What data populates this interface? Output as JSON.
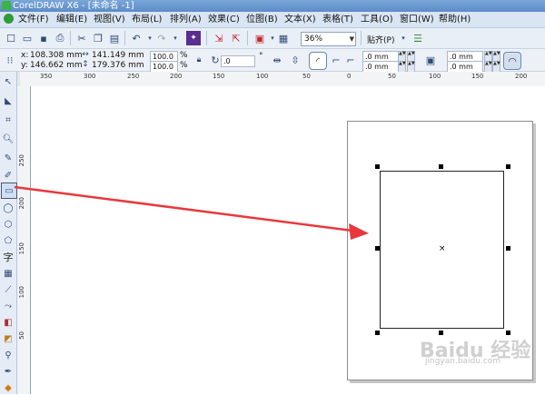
{
  "window": {
    "title": "CorelDRAW X6 - [未命名 -1]"
  },
  "menu": {
    "items": [
      "文件(F)",
      "编辑(E)",
      "视图(V)",
      "布局(L)",
      "排列(A)",
      "效果(C)",
      "位图(B)",
      "文本(X)",
      "表格(T)",
      "工具(O)",
      "窗口(W)",
      "帮助(H)"
    ]
  },
  "toolbar": {
    "zoom_value": "36%",
    "snap_label": "贴齐(P)"
  },
  "properties": {
    "x_label": "x:",
    "x_value": "108.308 mm",
    "y_label": "y:",
    "y_value": "146.662 mm",
    "width_value": "141.149 mm",
    "height_value": "179.376 mm",
    "scale_x": "100.0",
    "scale_y": "100.0",
    "percent": "%",
    "rotation": ".0",
    "degree": "°",
    "corner_1": ".0 mm",
    "corner_2": ".0 mm",
    "corner_3": ".0 mm",
    "corner_4": ".0 mm"
  },
  "ruler": {
    "top_labels": [
      "350",
      "300",
      "250",
      "200",
      "150",
      "100",
      "50",
      "0",
      "50",
      "100",
      "150",
      "200"
    ],
    "left_labels": [
      "250",
      "200",
      "150",
      "100",
      "50"
    ]
  },
  "toolbox": {
    "text_tool_glyph": "字"
  },
  "watermark": {
    "text": "Baidu 经验",
    "sub": "jingyan.baidu.com"
  },
  "colors": {
    "accent": "#e8383d",
    "menubar": "#d9e5f3",
    "titlebar": "#5c8cc8"
  }
}
